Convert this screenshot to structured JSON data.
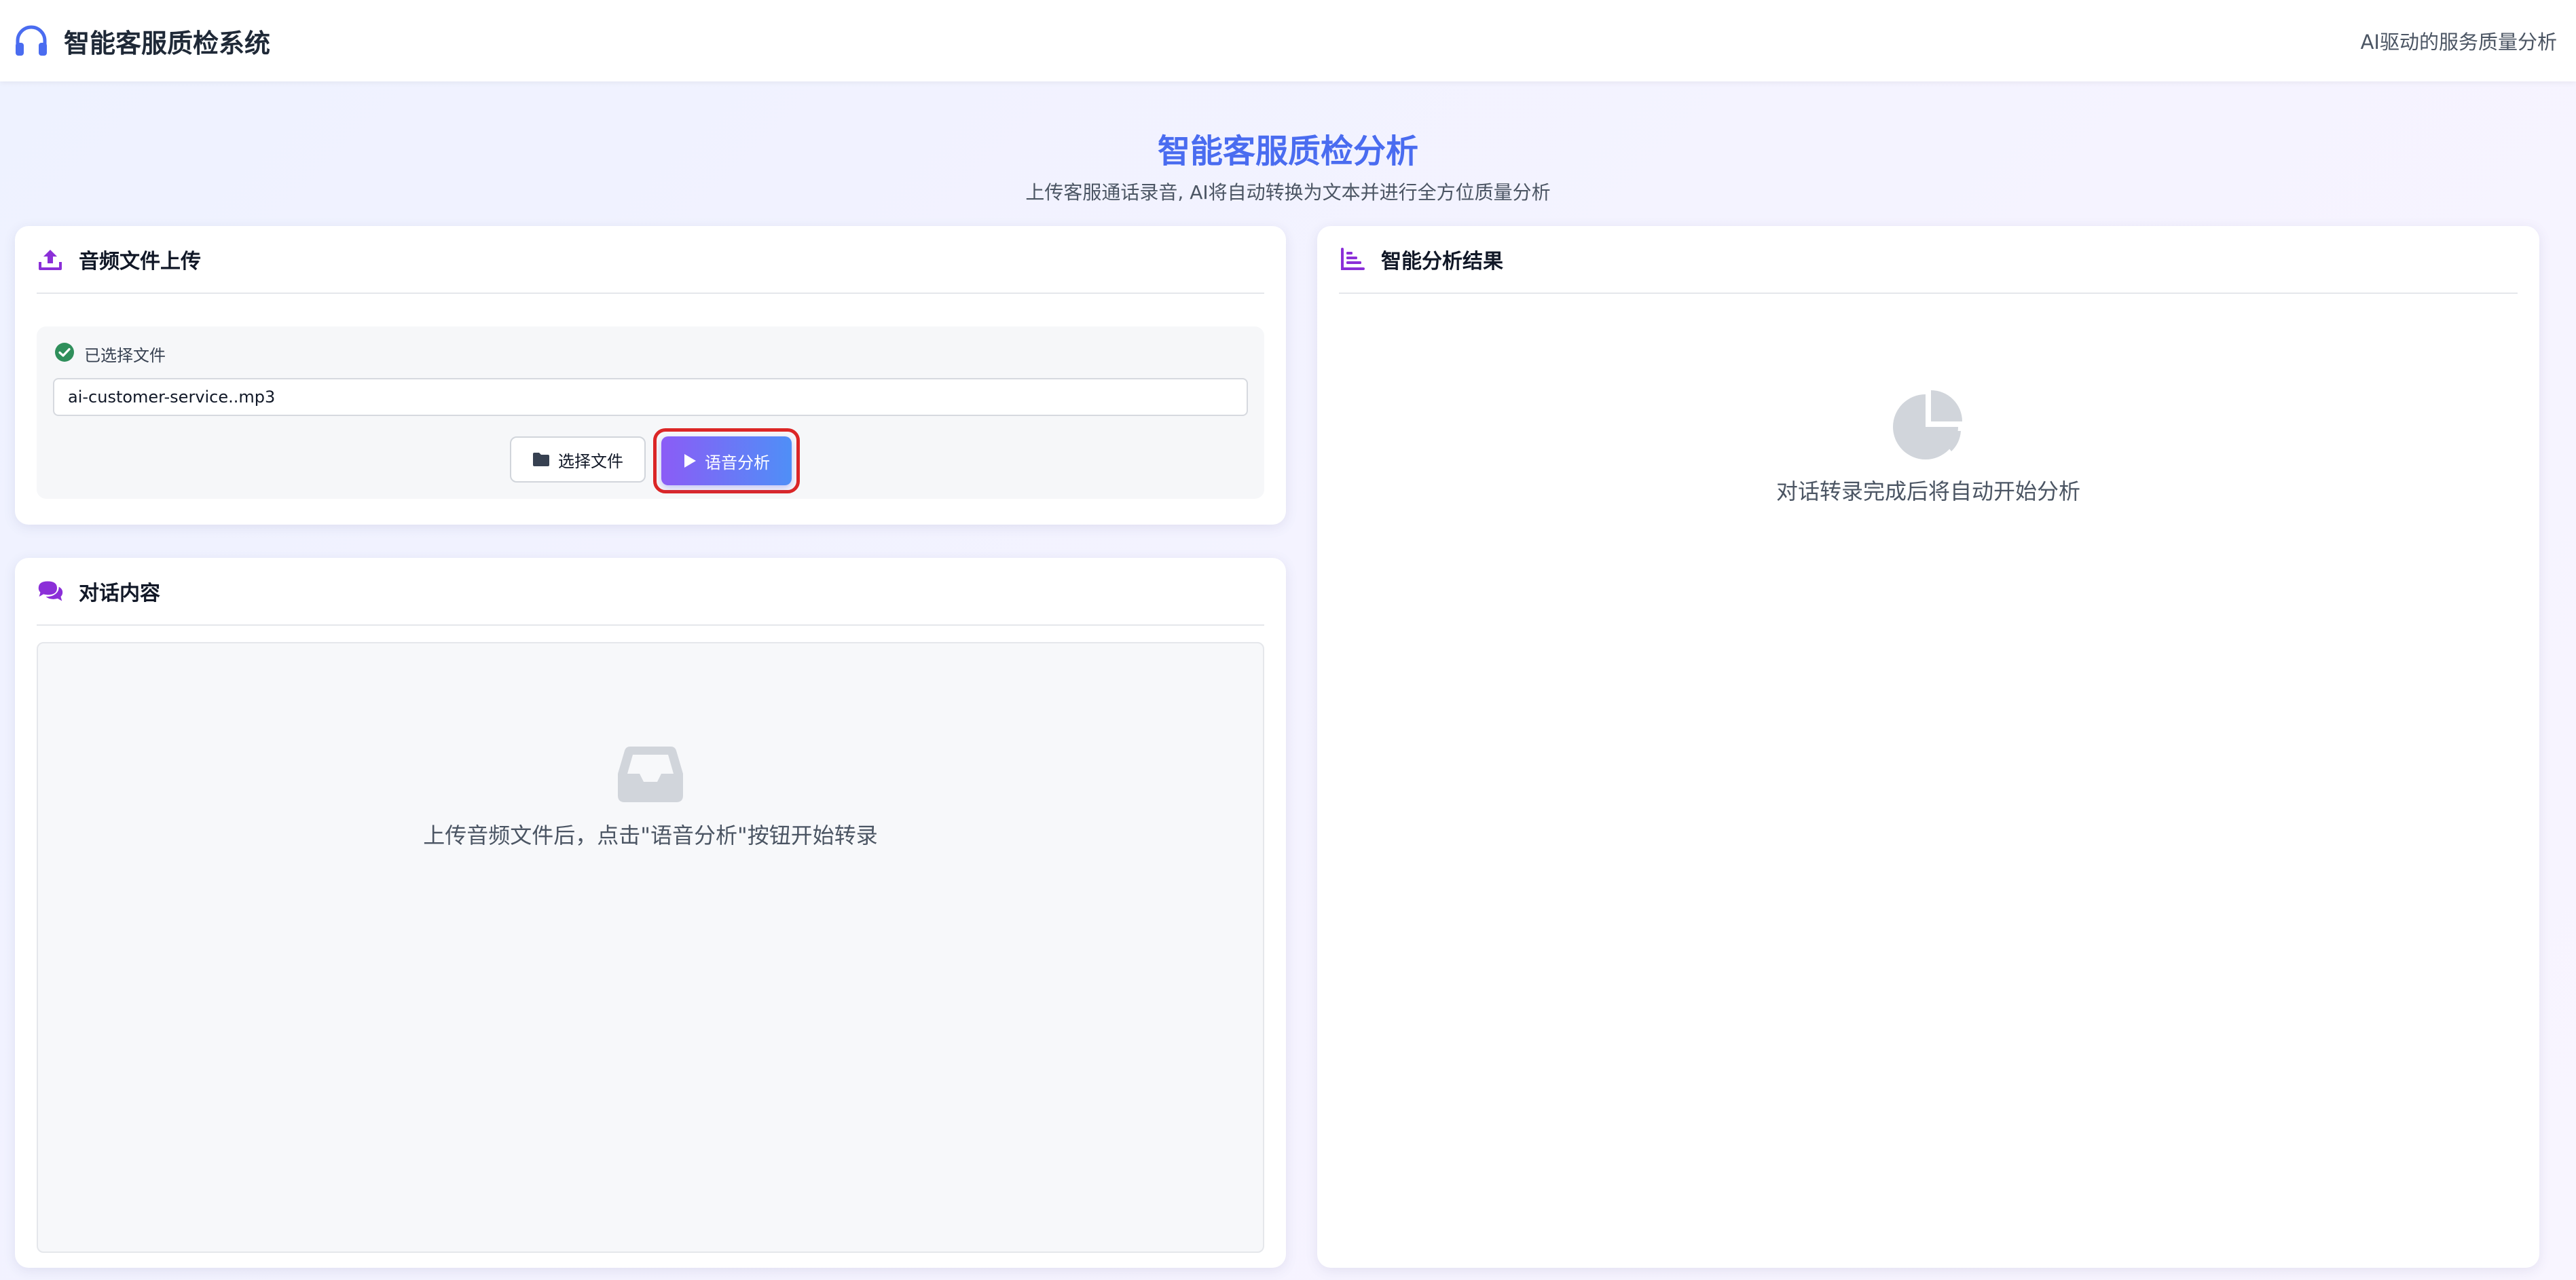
{
  "header": {
    "app_title": "智能客服质检系统",
    "tagline": "AI驱动的服务质量分析",
    "logo_icon": "headphones-icon"
  },
  "hero": {
    "title": "智能客服质检分析",
    "subtitle": "上传客服通话录音, AI将自动转换为文本并进行全方位质量分析"
  },
  "upload": {
    "title": "音频文件上传",
    "icon": "upload-icon",
    "status_label": "已选择文件",
    "status_icon": "check-circle-icon",
    "file_name": "ai-customer-service..mp3",
    "choose_button": "选择文件",
    "choose_icon": "folder-icon",
    "analyze_button": "语音分析",
    "analyze_icon": "play-icon"
  },
  "dialog": {
    "title": "对话内容",
    "icon": "comments-icon",
    "empty_icon": "inbox-icon",
    "empty_text": "上传音频文件后，点击\"语音分析\"按钮开始转录"
  },
  "result": {
    "title": "智能分析结果",
    "icon": "bar-chart-icon",
    "empty_icon": "pie-chart-icon",
    "empty_text": "对话转录完成后将自动开始分析"
  },
  "colors": {
    "accent": "#4a6cf0",
    "purple": "#8b2fd8",
    "highlight_outline": "#dc2626",
    "success": "#2f8f5b"
  }
}
